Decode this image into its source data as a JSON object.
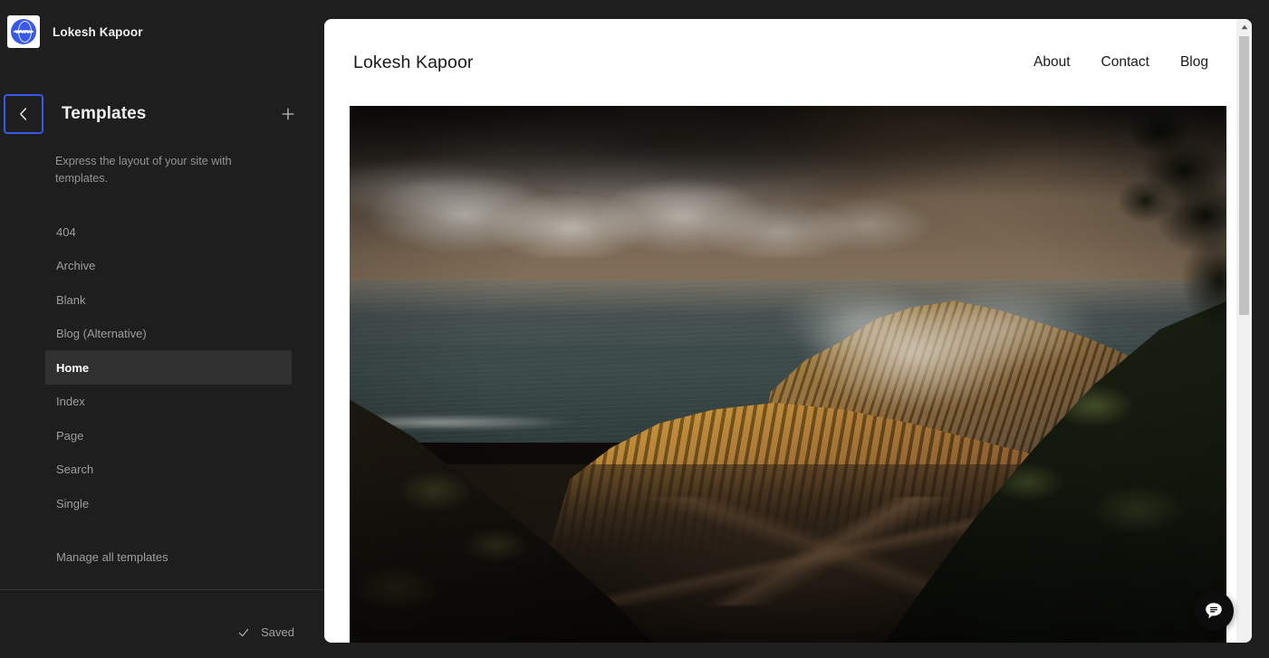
{
  "sidebar": {
    "site_hub": {
      "icon": "globe-www-icon",
      "globe_label": "www",
      "site_title": "Lokesh Kapoor"
    },
    "panel": {
      "back_icon": "chevron-left-icon",
      "title": "Templates",
      "add_icon": "plus-icon",
      "description": "Express the layout of your site with templates."
    },
    "templates": [
      {
        "label": "404",
        "selected": false
      },
      {
        "label": "Archive",
        "selected": false
      },
      {
        "label": "Blank",
        "selected": false
      },
      {
        "label": "Blog (Alternative)",
        "selected": false
      },
      {
        "label": "Home",
        "selected": true
      },
      {
        "label": "Index",
        "selected": false
      },
      {
        "label": "Page",
        "selected": false
      },
      {
        "label": "Search",
        "selected": false
      },
      {
        "label": "Single",
        "selected": false
      }
    ],
    "manage_all": "Manage all templates",
    "footer": {
      "save_status": "Saved",
      "check_icon": "check-icon"
    }
  },
  "canvas": {
    "site": {
      "brand": "Lokesh Kapoor",
      "nav": [
        {
          "label": "About"
        },
        {
          "label": "Contact"
        },
        {
          "label": "Blog"
        }
      ],
      "hero_alt": "Dark dramatic coastal mountain landscape at dusk"
    },
    "scrollbar": {
      "up_arrow_icon": "triangle-up-icon",
      "thumb": "scrollbar-thumb"
    },
    "chat": {
      "icon": "chat-bubble-icon",
      "label": "Chat"
    }
  },
  "colors": {
    "accent": "#3858e9",
    "sidebar_bg": "#1e1e1e",
    "selected_row_bg": "#303030",
    "canvas_bg": "#ffffff",
    "scrollbar_track": "#f1f1f1",
    "scrollbar_thumb": "#c1c1c1",
    "chat_fab_bg": "#0c0c0c"
  }
}
